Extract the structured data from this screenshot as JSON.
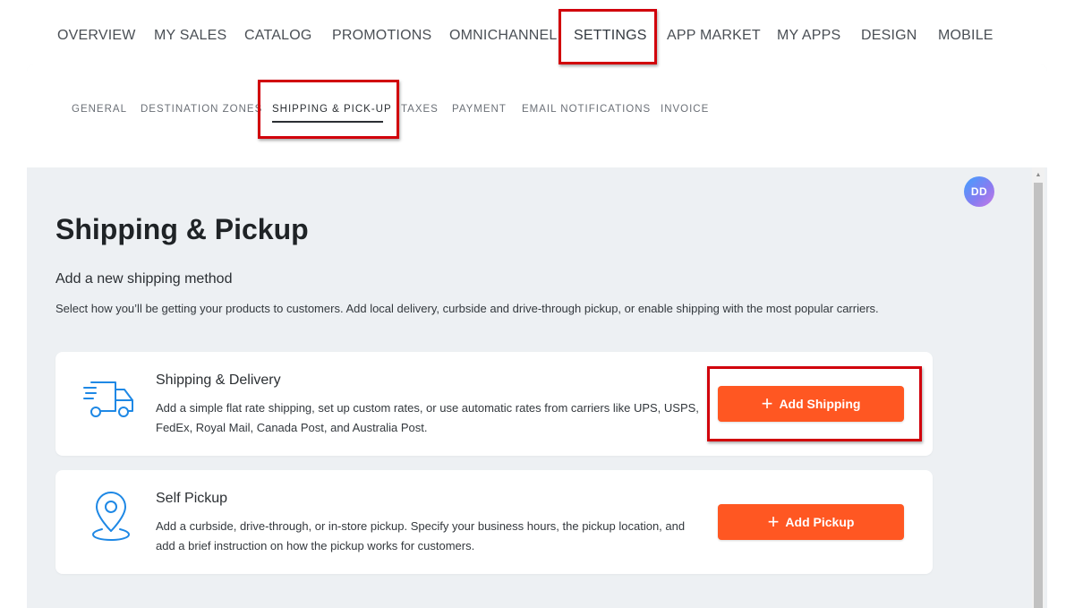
{
  "top_nav": {
    "items": [
      {
        "label": "OVERVIEW"
      },
      {
        "label": "MY SALES"
      },
      {
        "label": "CATALOG"
      },
      {
        "label": "PROMOTIONS"
      },
      {
        "label": "OMNICHANNEL"
      },
      {
        "label": "SETTINGS",
        "active": true
      },
      {
        "label": "APP MARKET"
      },
      {
        "label": "MY APPS"
      },
      {
        "label": "DESIGN"
      },
      {
        "label": "MOBILE"
      }
    ]
  },
  "sub_nav": {
    "items": [
      {
        "label": "GENERAL"
      },
      {
        "label": "DESTINATION ZONES"
      },
      {
        "label": "SHIPPING & PICK-UP",
        "active": true
      },
      {
        "label": "TAXES"
      },
      {
        "label": "PAYMENT"
      },
      {
        "label": "EMAIL NOTIFICATIONS"
      },
      {
        "label": "INVOICE"
      }
    ]
  },
  "avatar": {
    "initials": "DD"
  },
  "page": {
    "title": "Shipping & Pickup",
    "section_title": "Add a new shipping method",
    "section_desc": "Select how you’ll be getting your products to customers. Add local delivery, curbside and drive-through pickup, or enable shipping with the most popular carriers."
  },
  "cards": [
    {
      "icon": "delivery-truck-icon",
      "title": "Shipping & Delivery",
      "desc": "Add a simple flat rate shipping, set up custom rates, or use automatic rates from carriers like UPS, USPS, FedEx, Royal Mail, Canada Post, and Australia Post.",
      "button_label": "Add Shipping"
    },
    {
      "icon": "location-pin-icon",
      "title": "Self Pickup",
      "desc": "Add a curbside, drive-through, or in-store pickup. Specify your business hours, the pickup location, and add a brief instruction on how the pickup works for customers.",
      "button_label": "Add Pickup"
    }
  ],
  "colors": {
    "accent": "#ff5722",
    "highlight": "#d1000b",
    "icon_blue": "#1e88e5",
    "panel_bg": "#edf0f3"
  }
}
